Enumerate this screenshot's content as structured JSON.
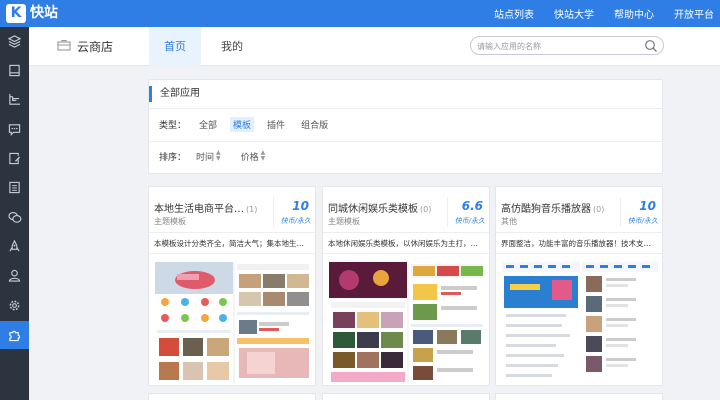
{
  "topbar": {
    "logo_letter": "K",
    "brand": "快站",
    "nav": [
      "站点列表",
      "快站大学",
      "帮助中心",
      "开放平台"
    ]
  },
  "sidebar": {
    "icons": [
      "layers-icon",
      "page-icon",
      "tree-icon",
      "message-icon",
      "edit-page-icon",
      "list-doc-icon",
      "chat-icon",
      "rocket-icon",
      "user-icon",
      "gear-icon",
      "puzzle-icon"
    ],
    "active_index": 10
  },
  "header": {
    "title": "云商店",
    "tabs": [
      "首页",
      "我的"
    ],
    "search_placeholder": "请输入应用的名称"
  },
  "filter": {
    "title": "全部应用",
    "type_label": "类型：",
    "type_options": [
      "全部",
      "模板",
      "插件",
      "组合版"
    ],
    "type_active": 1,
    "sort_label": "排序：",
    "sort_options": [
      "时间",
      "价格"
    ]
  },
  "cards": [
    {
      "name": "本地生活电商平台…",
      "count": "(1)",
      "type": "主题模板",
      "price": "10",
      "unit": "快币/永久",
      "desc": "本模板设计分类齐全，简洁大气；集本地生…"
    },
    {
      "name": "同城休闲娱乐类模板",
      "count": "(0)",
      "type": "主题模板",
      "price": "6.6",
      "unit": "快币/永久",
      "desc": "本地休闲娱乐类模板，以休闲娱乐为主打，…"
    },
    {
      "name": "高仿酷狗音乐播放器",
      "count": "(0)",
      "type": "其他",
      "price": "10",
      "unit": "快币/永久",
      "desc": "界面整洁，功能丰富的音乐播放器！技术支…"
    }
  ],
  "colors": {
    "primary": "#2f7ee6",
    "sidebar_bg": "#2c3440",
    "page_bg": "#f0f2f5"
  }
}
